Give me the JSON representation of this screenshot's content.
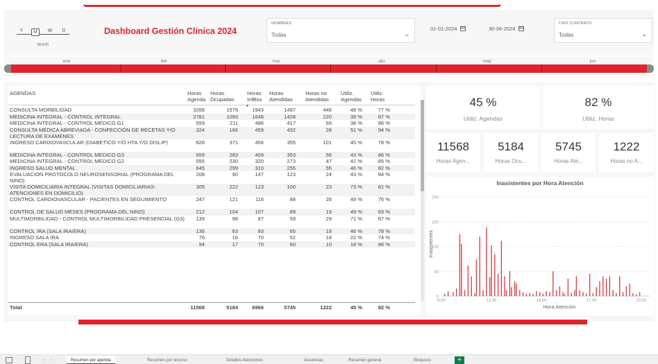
{
  "header": {
    "title": "Dashboard Gestión Clínica 2024",
    "date_hierarchy": {
      "letters": [
        "Y",
        "M",
        "W",
        "D"
      ],
      "selected": "M",
      "caption": "Month"
    }
  },
  "filters": {
    "nombres": {
      "label": "NOMBRES",
      "value": "Todas"
    },
    "date_from": "01-01-2024",
    "date_to": "30-06-2024",
    "tipo_contrato": {
      "label": "TIPO CONTRATO",
      "value": "Todas"
    }
  },
  "months": [
    "ene",
    "feb",
    "mar",
    "abr",
    "may",
    "jun"
  ],
  "table": {
    "headers": [
      "AGENDAS",
      "Horas Agenda",
      "Horas Ocupadas",
      "Horas InfBox",
      "Horas Atendidas",
      "Horas no Atendidas",
      "Utiliz. Agendas",
      "Utiliz. Horas"
    ],
    "rows": [
      [
        "CONSULTA MORBILIDAD",
        "3268",
        "1579",
        "1943",
        "1497",
        "446",
        "48 %",
        "77 %"
      ],
      [
        "MEDICINA INTEGRAL - CONTROL INTEGRAL",
        "2781",
        "1093",
        "1648",
        "1428",
        "220",
        "39 %",
        "87 %"
      ],
      [
        "MEDICINA INTEGRAL - CONTROL MEDICO G1",
        "559",
        "211",
        "486",
        "417",
        "69",
        "38 %",
        "86 %"
      ],
      [
        "CONSULTA MÉDICA ABREVIADA - CONFECCIÓN DE RECETAS Y/O LECTURA DE EXÁMENES",
        "324",
        "166",
        "459",
        "432",
        "28",
        "51 %",
        "94 %"
      ],
      [
        "INGRESO CARDIOVASCULAR (DIABETICO Y/O HTA Y/O DISLIP)",
        "828",
        "371",
        "456",
        "355",
        "101",
        "45 %",
        "78 %"
      ],
      [
        "MEDICINA INTEGRAL - CONTROL MEDICO G3",
        "659",
        "283",
        "409",
        "353",
        "56",
        "43 %",
        "86 %"
      ],
      [
        "MEDICINA INTEGRAL - CONTROL MEDICO G2",
        "555",
        "230",
        "320",
        "273",
        "47",
        "41 %",
        "85 %"
      ],
      [
        "INGRESO SALUD MENTAL",
        "645",
        "299",
        "310",
        "255",
        "55",
        "46 %",
        "82 %"
      ],
      [
        "EVALUACION PROTOCOLO NEUROSENSORIAL (PROGRAMA DEL NINO)",
        "208",
        "90",
        "147",
        "123",
        "24",
        "43 %",
        "84 %"
      ],
      [
        "VISITA DOMICILIARIA INTEGRAL (VISITAS DOMICILIARIAS-ATENCIONES EN DOMICILIO)",
        "305",
        "222",
        "123",
        "100",
        "23",
        "73 %",
        "81 %"
      ],
      [
        "CONTROL CARDIOVASCULAR - PACIENTES EN SEGUIMIENTO",
        "247",
        "121",
        "116",
        "88",
        "28",
        "49 %",
        "76 %"
      ],
      [
        "CONTROL DE SALUD MESES (PROGRAMA DEL NINO)",
        "212",
        "104",
        "107",
        "89",
        "19",
        "49 %",
        "83 %"
      ],
      [
        "MULTIMORBILIDAD - CONTROL MULTIMORBILIDAD PRESENCIAL (G3)",
        "139",
        "98",
        "87",
        "59",
        "29",
        "71 %",
        "67 %"
      ],
      [
        "CONTROL IRA (SALA IRA/ERA)",
        "136",
        "63",
        "83",
        "65",
        "18",
        "46 %",
        "78 %"
      ],
      [
        "INGRESO SALA IRA",
        "76",
        "16",
        "70",
        "52",
        "18",
        "22 %",
        "74 %"
      ],
      [
        "CONTROL ERA (SALA IRA/ERA)",
        "94",
        "17",
        "70",
        "60",
        "10",
        "18 %",
        "86 %"
      ]
    ],
    "total": [
      "Total",
      "11568",
      "5184",
      "6966",
      "5745",
      "1222",
      "45 %",
      "82 %"
    ]
  },
  "kpis": {
    "utiliz_agendas": {
      "value": "45 %",
      "label": "Utiliz. Agendas"
    },
    "utiliz_horas": {
      "value": "82 %",
      "label": "Utiliz. Horas"
    },
    "horas_agenda": {
      "value": "11568",
      "label": "Horas Agen..."
    },
    "horas_ocupadas": {
      "value": "5184",
      "label": "Horas Ocu..."
    },
    "horas_atendidas": {
      "value": "5745",
      "label": "Horas Ate..."
    },
    "horas_no_atendidas": {
      "value": "1222",
      "label": "Horas no A..."
    }
  },
  "chart_data": {
    "type": "bar",
    "title": "Inasistentes por Hora Atención",
    "xlabel": "Hora Atención",
    "ylabel": "Inasistentes",
    "ylim": [
      0,
      210
    ],
    "yticks": [
      0,
      50,
      100,
      150,
      200
    ],
    "xlim": [
      8,
      20.5
    ],
    "xticks": [
      8,
      11,
      14,
      17,
      20
    ],
    "xtick_labels": [
      "8:00",
      "11:00",
      "14:00",
      "17:00",
      "20:00"
    ],
    "grid": true,
    "color": "#d9424a",
    "x": [
      8.2,
      8.4,
      8.7,
      8.9,
      9.1,
      9.2,
      9.4,
      9.6,
      9.8,
      10.0,
      10.1,
      10.3,
      10.5,
      10.7,
      10.9,
      11.0,
      11.2,
      11.4,
      11.6,
      11.8,
      11.9,
      12.1,
      12.2,
      12.4,
      12.5,
      12.7,
      12.9,
      13.1,
      13.3,
      13.5,
      13.7,
      13.9,
      14.1,
      14.3,
      14.5,
      14.7,
      14.9,
      15.1,
      15.3,
      15.4,
      15.6,
      15.8,
      16.0,
      16.1,
      16.3,
      16.5,
      16.7,
      16.9,
      17.1,
      17.3,
      17.5,
      17.7,
      17.9,
      18.1,
      18.3,
      18.5,
      18.7,
      18.9,
      19.1,
      19.3,
      19.5,
      19.7,
      19.9
    ],
    "values": [
      5,
      10,
      8,
      15,
      125,
      105,
      12,
      62,
      40,
      6,
      74,
      120,
      12,
      138,
      38,
      102,
      85,
      45,
      112,
      40,
      12,
      50,
      18,
      30,
      25,
      12,
      8,
      5,
      6,
      4,
      10,
      8,
      5,
      10,
      8,
      50,
      12,
      20,
      8,
      4,
      35,
      6,
      12,
      40,
      12,
      8,
      5,
      45,
      6,
      18,
      30,
      40,
      35,
      40,
      12,
      6,
      40,
      8,
      20,
      25,
      6,
      4,
      8
    ]
  },
  "bottom_tabs": [
    "Resumen por agenda",
    "Resumen por recurso",
    "Detalles Atenciones",
    "Ausencias",
    "Resumen general",
    "Bloqueos"
  ],
  "active_tab": "Resumen por agenda",
  "add_tab_label": "+"
}
